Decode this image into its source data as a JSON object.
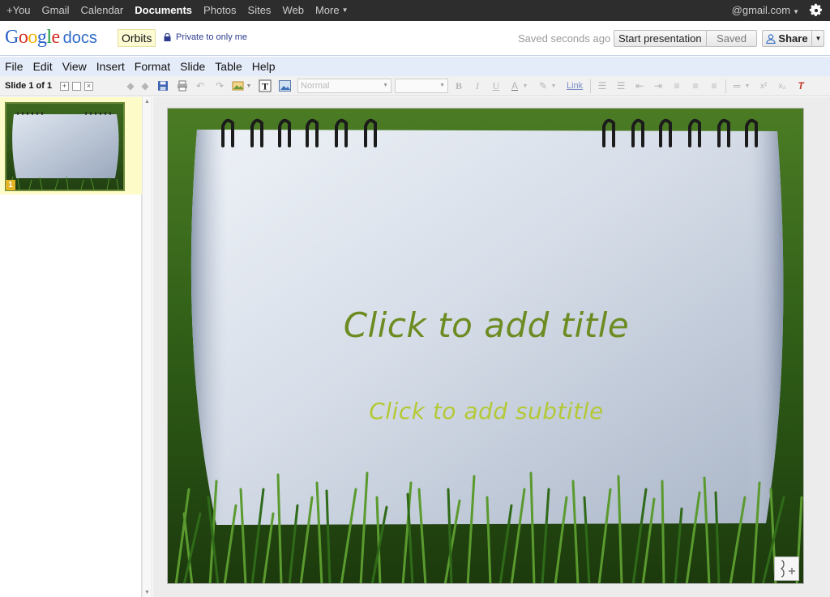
{
  "gbar": {
    "nav": [
      "+You",
      "Gmail",
      "Calendar",
      "Documents",
      "Photos",
      "Sites",
      "Web",
      "More"
    ],
    "active": "Documents",
    "account": "@gmail.com",
    "settings_icon": "gear-icon"
  },
  "header": {
    "logo_google": "Google",
    "logo_docs": "docs",
    "doc_title": "Orbits",
    "privacy": "Private to only me",
    "save_status": "Saved seconds ago",
    "present_label": "Start presentation",
    "saved_label": "Saved",
    "share_label": "Share"
  },
  "menubar": [
    "File",
    "Edit",
    "View",
    "Insert",
    "Format",
    "Slide",
    "Table",
    "Help"
  ],
  "toolbar": {
    "slide_counter": "Slide 1 of 1",
    "style_select": "Normal",
    "font_select": "",
    "link_label": "Link"
  },
  "filmstrip": {
    "slides": [
      {
        "number": "1"
      }
    ]
  },
  "slide": {
    "title_placeholder": "Click to add title",
    "subtitle_placeholder": "Click to add subtitle"
  },
  "colors": {
    "gbar_bg": "#2d2d2d",
    "menubar_bg": "#e5ecf9",
    "title_color": "#6c8c22",
    "subtitle_color": "#b4c936",
    "thumb_highlight": "#fdfbc8"
  }
}
